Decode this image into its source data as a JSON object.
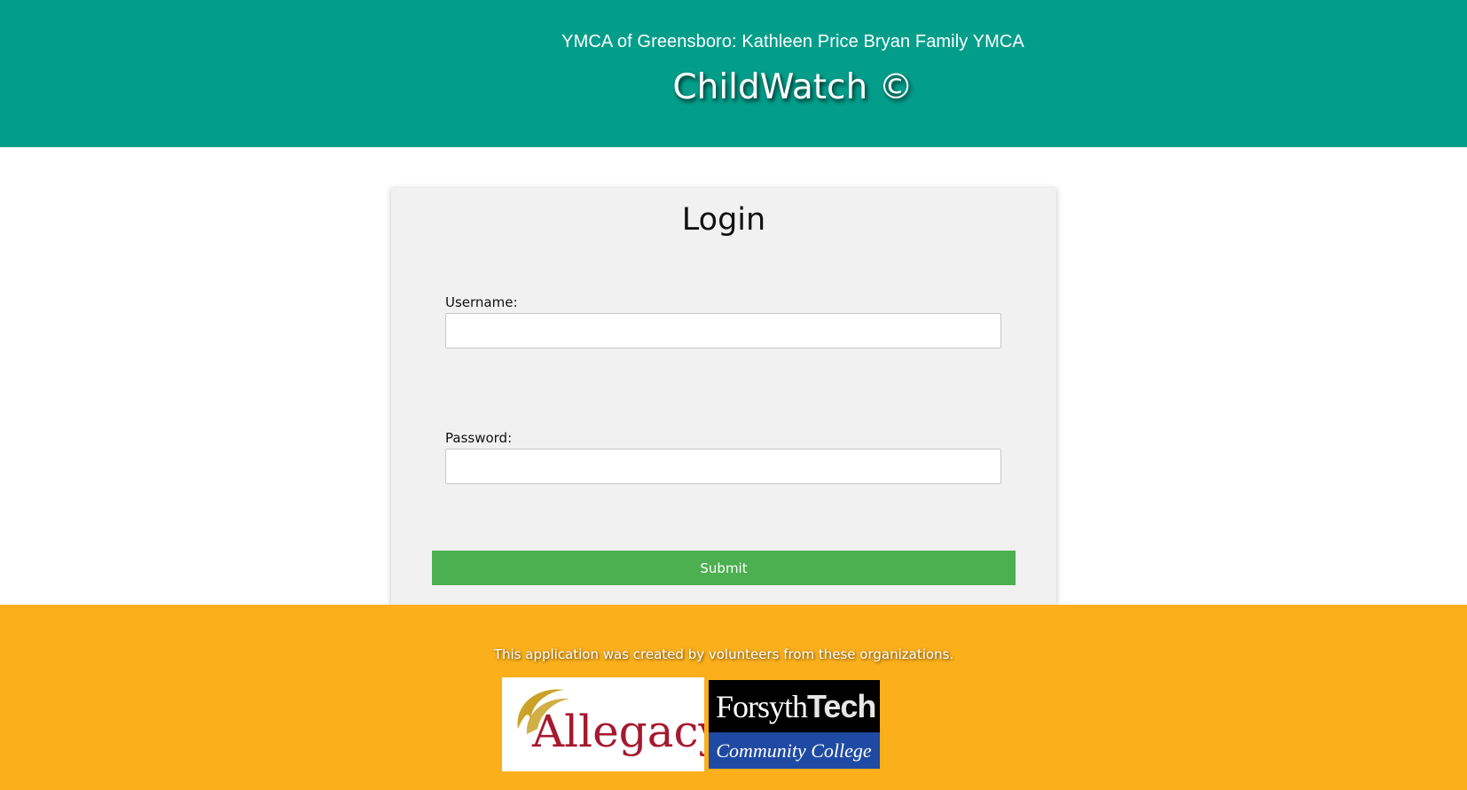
{
  "header": {
    "org_name": "YMCA of Greensboro: Kathleen Price Bryan Family YMCA",
    "app_title": "ChildWatch ©",
    "background_color": "#039e8a"
  },
  "login": {
    "title": "Login",
    "username_label": "Username:",
    "username_value": "",
    "password_label": "Password:",
    "password_value": "",
    "submit_label": "Submit",
    "submit_color": "#4caf50"
  },
  "footer": {
    "text": "This application was created by volunteers from these organizations.",
    "background_color": "#fbaf1b",
    "logos": {
      "allegacy": {
        "name": "Allegacy",
        "text_color": "#a6192e",
        "swoosh_color": "#c9a227"
      },
      "forsyth": {
        "name_part1": "Forsyth",
        "name_part2": "Tech",
        "subtitle": "Community College",
        "bottom_color": "#1f4aa3"
      }
    }
  }
}
